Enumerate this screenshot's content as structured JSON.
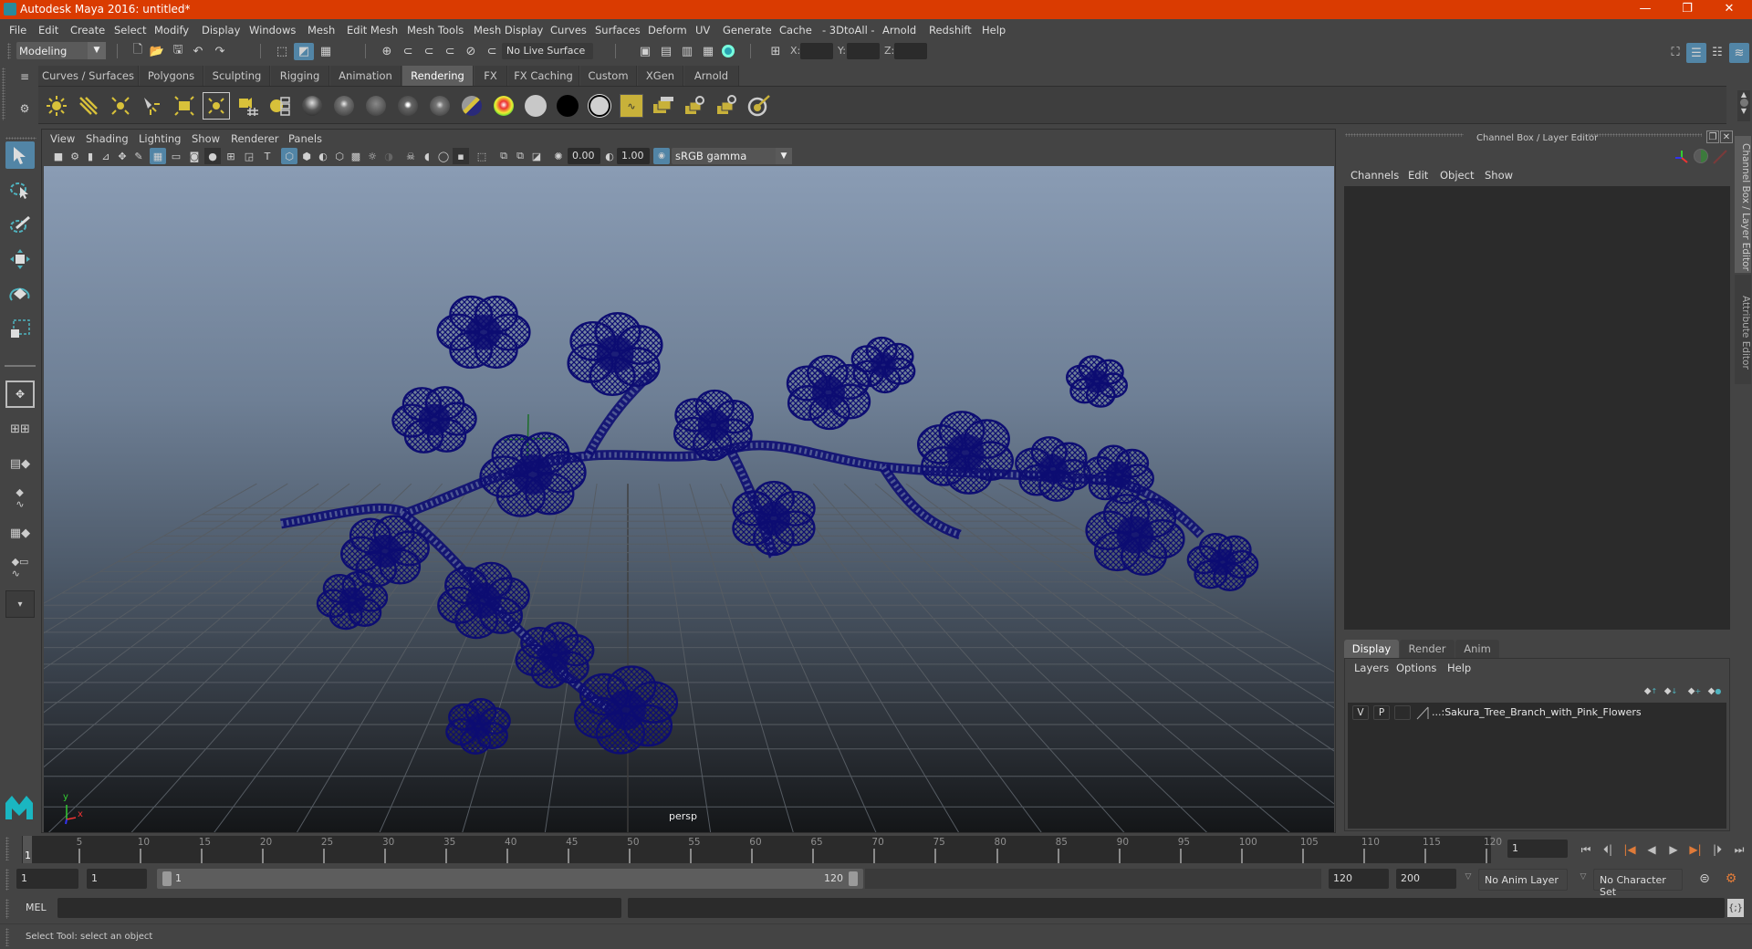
{
  "window": {
    "title": "Autodesk Maya 2016: untitled*",
    "controls": {
      "minimize": "—",
      "restore": "❐",
      "close": "✕"
    }
  },
  "menubar": [
    "File",
    "Edit",
    "Create",
    "Select",
    "Modify",
    "Display",
    "Windows",
    "Mesh",
    "Edit Mesh",
    "Mesh Tools",
    "Mesh Display",
    "Curves",
    "Surfaces",
    "Deform",
    "UV",
    "Generate",
    "Cache",
    "- 3DtoAll -",
    "Arnold",
    "Redshift",
    "Help"
  ],
  "statusline": {
    "menuset": "Modeling",
    "live_surface": "No Live Surface",
    "x_label": "X:",
    "y_label": "Y:",
    "z_label": "Z:",
    "x_value": "",
    "y_value": "",
    "z_value": ""
  },
  "shelf": {
    "tabs": [
      "Curves / Surfaces",
      "Polygons",
      "Sculpting",
      "Rigging",
      "Animation",
      "Rendering",
      "FX",
      "FX Caching",
      "Custom",
      "XGen",
      "Arnold"
    ],
    "active_tab": "Rendering",
    "icons": [
      "ambient-light-icon",
      "directional-light-icon",
      "point-light-icon",
      "spot-light-icon",
      "area-light-icon",
      "volume-light-icon",
      "camera-aim-icon",
      "hypershade-icon",
      "anisotropic-material-icon",
      "blinn-material-icon",
      "lambert-material-icon",
      "phong-material-icon",
      "phonge-material-icon",
      "layered-shader-icon",
      "ramp-shader-icon",
      "surface-shader-gray-icon",
      "surface-shader-black-icon",
      "use-background-icon",
      "render-view-icon",
      "render-current-frame-icon",
      "ipr-render-icon",
      "render-settings-icon",
      "paint-effects-icon"
    ]
  },
  "viewport": {
    "menus": [
      "View",
      "Shading",
      "Lighting",
      "Show",
      "Renderer",
      "Panels"
    ],
    "exposure": "0.00",
    "gamma": "1.00",
    "color_space": "sRGB gamma",
    "camera_label": "persp",
    "axis": {
      "x": "x",
      "y": "y",
      "z": "z"
    },
    "wire_color": "#0d0d72",
    "grid_color": "#565c63"
  },
  "right_panel": {
    "title": "Channel Box / Layer Editor",
    "channel_menus": [
      "Channels",
      "Edit",
      "Object",
      "Show"
    ],
    "layer_tabs": [
      "Display",
      "Render",
      "Anim"
    ],
    "active_layer_tab": "Display",
    "layer_menus": [
      "Layers",
      "Options",
      "Help"
    ],
    "layers": [
      {
        "visible": "V",
        "playback": "P",
        "name": "...:Sakura_Tree_Branch_with_Pink_Flowers"
      }
    ],
    "side_tabs": [
      "Channel Box / Layer Editor",
      "Attribute Editor"
    ]
  },
  "timeline": {
    "ticks": [
      "5",
      "10",
      "15",
      "20",
      "25",
      "30",
      "35",
      "40",
      "45",
      "50",
      "55",
      "60",
      "65",
      "70",
      "75",
      "80",
      "85",
      "90",
      "95",
      "100",
      "105",
      "110",
      "115",
      "120"
    ],
    "start_marker": "1",
    "current_frame": "1",
    "start_min": 1,
    "end_max": 120
  },
  "range": {
    "start_time": "1",
    "playback_start": "1",
    "slider_start": "1",
    "slider_end": "120",
    "playback_end": "120",
    "end_time": "200",
    "anim_layer": "No Anim Layer",
    "character_set": "No Character Set"
  },
  "command_line": {
    "label": "MEL",
    "input": "",
    "output": ""
  },
  "help_line": "Select Tool: select an object",
  "colors": {
    "title_bar": "#da3b01",
    "selected": "#5285a6",
    "accent_orange": "#e07b39"
  }
}
